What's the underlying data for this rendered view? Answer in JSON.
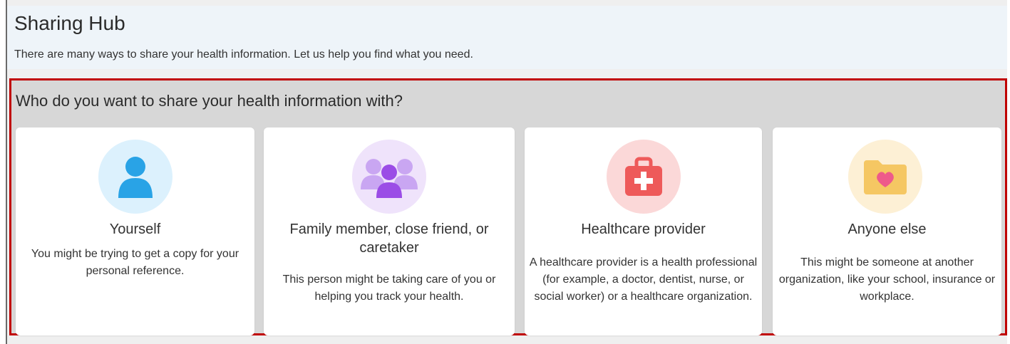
{
  "header": {
    "title": "Sharing Hub",
    "subtitle": "There are many ways to share your health information. Let us help you find what you need."
  },
  "section": {
    "title": "Who do you want to share your health information with?"
  },
  "cards": [
    {
      "title": "Yourself",
      "description": "You might be trying to get a copy for your personal reference.",
      "icon": "person-icon",
      "icon_bg": "#dcf1fd",
      "icon_color": "#29a3e6"
    },
    {
      "title": "Family member, close friend, or caretaker",
      "description": "This person might be taking care of you or helping you track your health.",
      "icon": "group-icon",
      "icon_bg": "#efe3fb",
      "icon_color": "#9b4de6"
    },
    {
      "title": "Healthcare provider",
      "description": "A healthcare provider is a health professional (for example, a doctor, dentist, nurse, or social worker) or a healthcare organization.",
      "icon": "medical-bag-icon",
      "icon_bg": "#fbd8d8",
      "icon_color": "#ee5a5a"
    },
    {
      "title": "Anyone else",
      "description": "This might be someone at another organization, like your school, insurance or workplace.",
      "icon": "folder-heart-icon",
      "icon_bg": "#fdf0d5",
      "icon_color": "#f5c763"
    }
  ]
}
